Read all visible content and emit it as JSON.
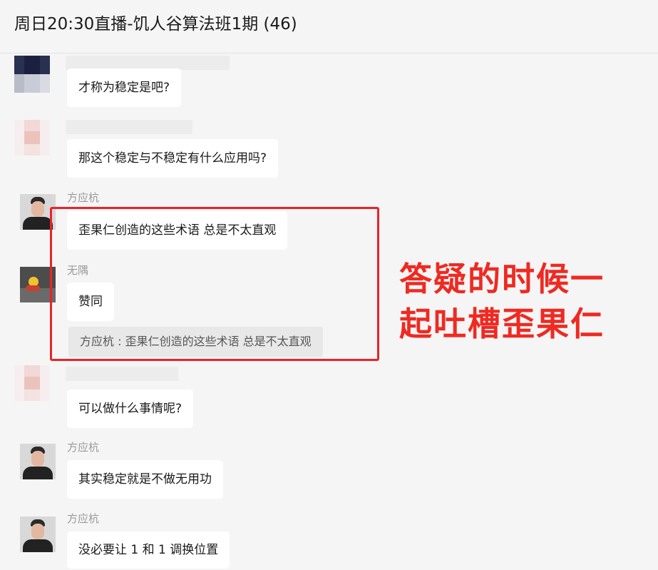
{
  "header": {
    "title": "周日20:30直播-饥人谷算法班1期 (46)"
  },
  "messages": [
    {
      "sender": "",
      "text": "才称为稳定是吧?"
    },
    {
      "sender": "",
      "text": "那这个稳定与不稳定有什么应用吗?"
    },
    {
      "sender": "方应杭",
      "text": "歪果仁创造的这些术语  总是不太直观"
    },
    {
      "sender": "无隅",
      "text": "赞同",
      "quote": "方应杭 : 歪果仁创造的这些术语  总是不太直观"
    },
    {
      "sender": "",
      "text": "可以做什么事情呢?"
    },
    {
      "sender": "方应杭",
      "text": "其实稳定就是不做无用功"
    },
    {
      "sender": "方应杭",
      "text": "没必要让 1 和 1 调换位置"
    }
  ],
  "annotation": {
    "line1": "答疑的时候一",
    "line2": "起吐槽歪果仁"
  },
  "colors": {
    "annotation": "#e8232b",
    "background": "#f5f5f5",
    "bubble": "#ffffff"
  }
}
